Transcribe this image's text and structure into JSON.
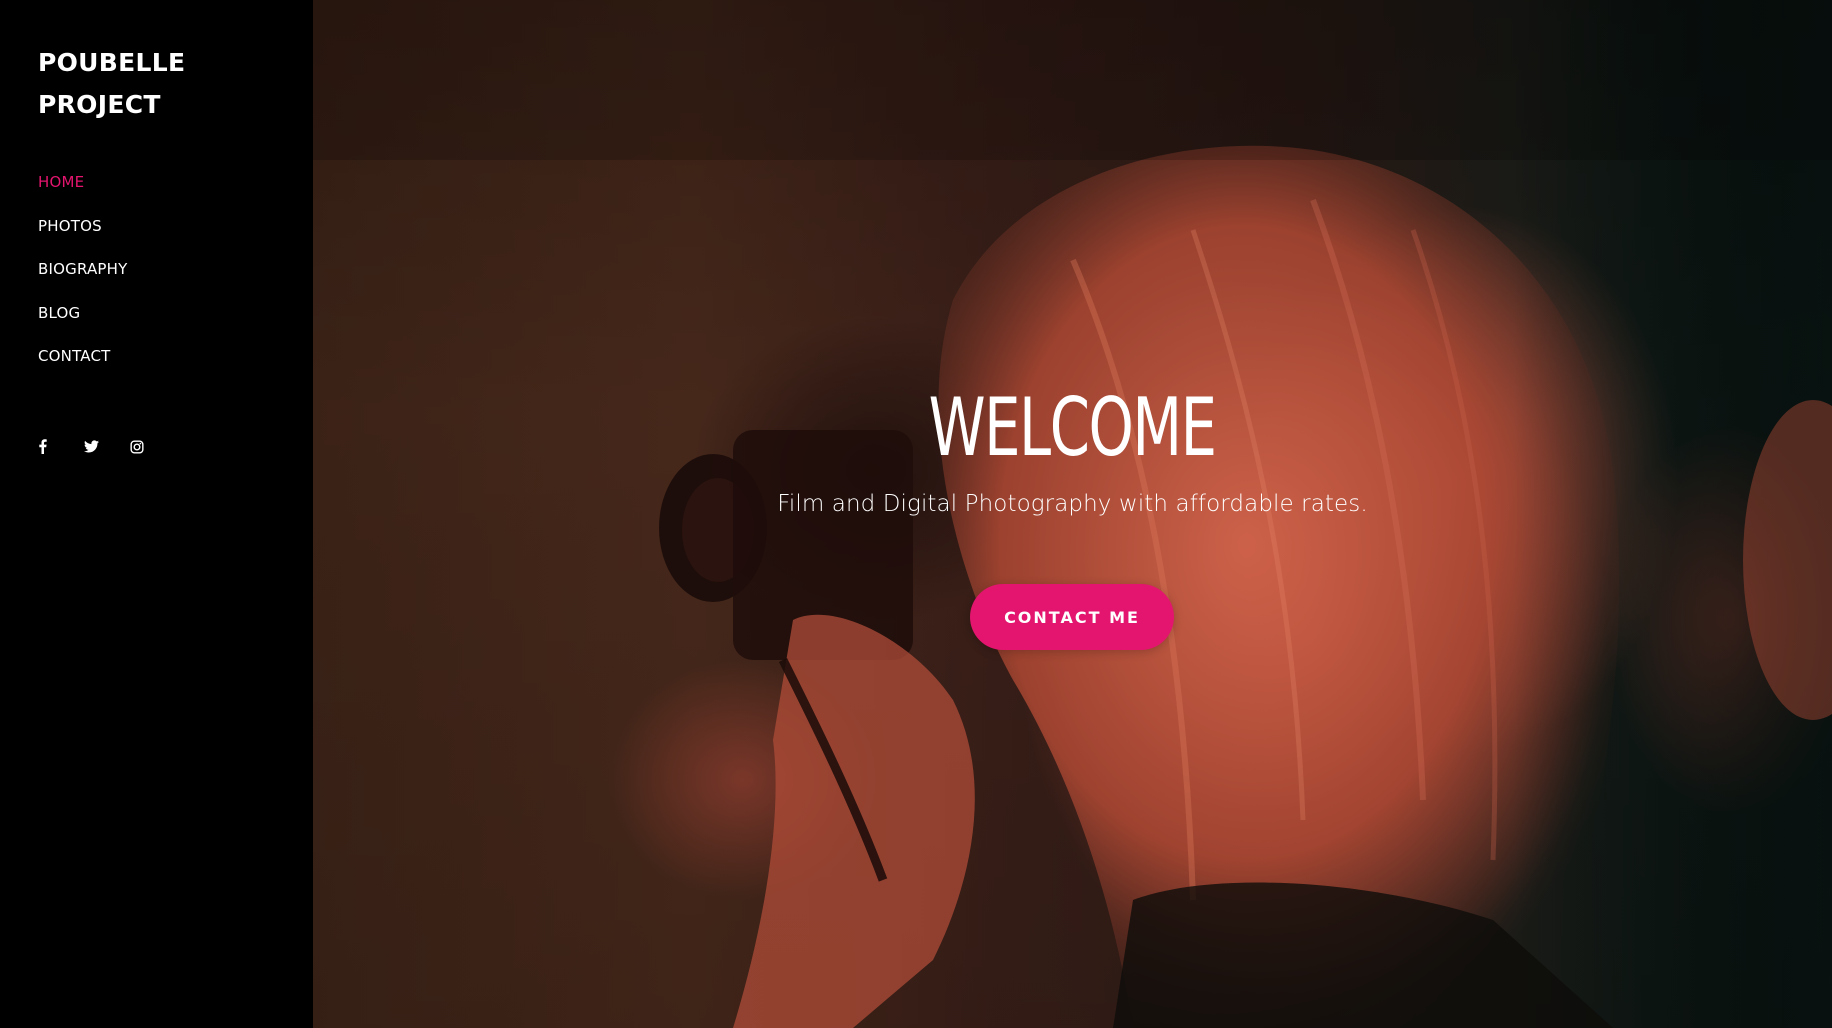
{
  "sidebar": {
    "brand": "POUBELLE PROJECT",
    "nav": [
      {
        "label": "HOME",
        "active": true
      },
      {
        "label": "PHOTOS",
        "active": false
      },
      {
        "label": "BIOGRAPHY",
        "active": false
      },
      {
        "label": "BLOG",
        "active": false
      },
      {
        "label": "CONTACT",
        "active": false
      }
    ],
    "social": [
      {
        "icon": "facebook-icon"
      },
      {
        "icon": "twitter-icon"
      },
      {
        "icon": "instagram-icon"
      }
    ]
  },
  "hero": {
    "background_image": "photographer-with-camera-photo",
    "title": "WELCOME",
    "subtitle": "Film and Digital Photography with affordable rates.",
    "cta_label": "CONTACT ME"
  },
  "colors": {
    "accent": "#e3156e",
    "sidebar_bg": "#000000",
    "text": "#ffffff"
  }
}
